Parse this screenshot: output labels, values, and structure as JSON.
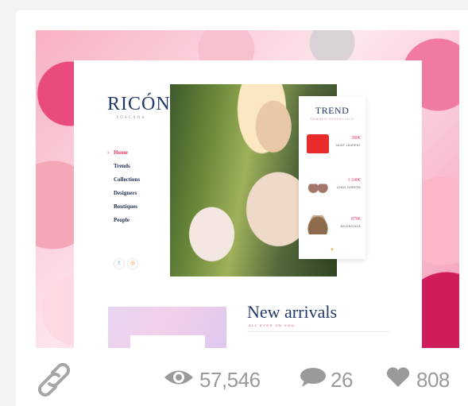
{
  "preview": {
    "logo": {
      "name": "RICÓNI",
      "sub": "TOSCANA"
    },
    "nav": [
      "Home",
      "Trends",
      "Collections",
      "Designers",
      "Boutiques",
      "People"
    ],
    "active_nav": "Home",
    "social": [
      "twitter-icon",
      "instagram-icon"
    ],
    "trend": {
      "title": "TREND",
      "subtitle": "SUMMER ESSENTIALS",
      "products": [
        {
          "price": "380€",
          "brand": "SAINT LAURENT"
        },
        {
          "price": "1 240€",
          "brand": "LINDA FARROW"
        },
        {
          "price": "870€",
          "brand": "BALENCIAGA"
        }
      ]
    },
    "new_arrivals": {
      "title": "New arrivals",
      "subtitle": "ALL EYES ON YOU"
    }
  },
  "stats": {
    "views": "57,546",
    "comments": "26",
    "likes": "808"
  },
  "colors": {
    "stat_gray": "#9a9a9a",
    "brand_navy": "#243a6a",
    "accent_pink": "#e03a62"
  }
}
